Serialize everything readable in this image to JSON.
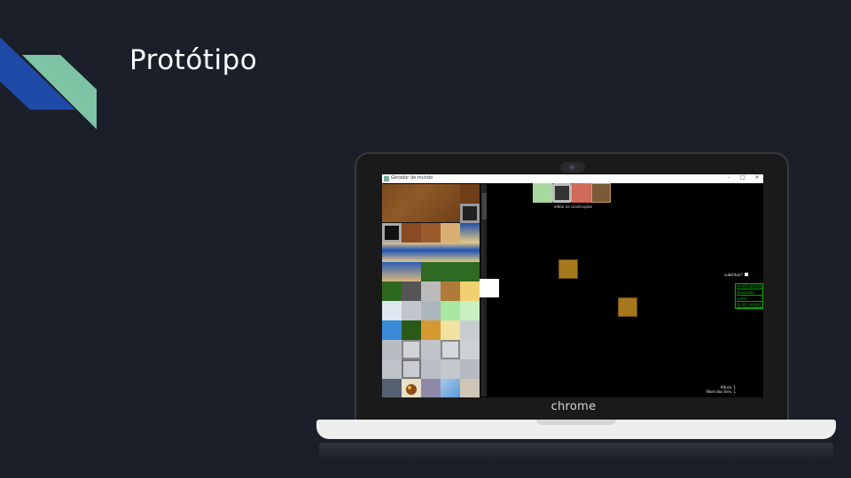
{
  "slide": {
    "title": "Protótipo"
  },
  "colors": {
    "background": "#1b1f2a",
    "accent_blue": "#1e4aa8",
    "accent_green": "#7ec4a4"
  },
  "laptop": {
    "brand": "chrome"
  },
  "app": {
    "window_title": "Gerador de mundo",
    "controls": [
      "–",
      "□",
      "✕"
    ],
    "toolbar_label": "editar as construções",
    "substitute_label": "substituir?",
    "log_lines": [
      "[0.0][1,00][0]",
      "[Eduardo]",
      "[sem]",
      "[0.0][1,00][0]"
    ],
    "status_height": "Altura: 1",
    "status_level": "Nível dos tiles: 1"
  },
  "icons": {
    "app_icon": "map-icon",
    "minimize": "minimize-icon",
    "maximize": "maximize-icon",
    "close": "close-icon"
  }
}
